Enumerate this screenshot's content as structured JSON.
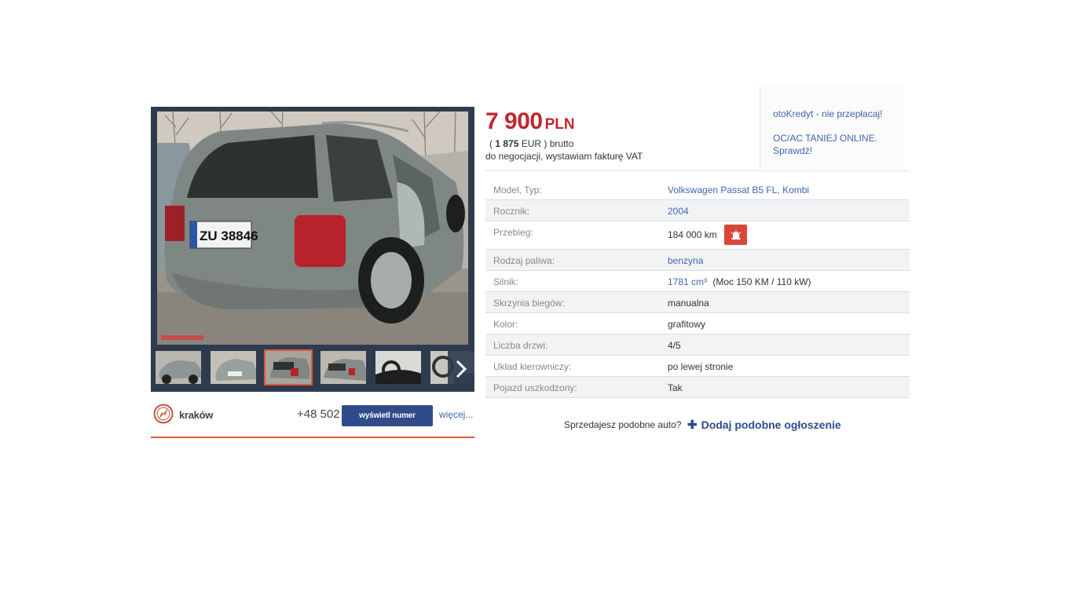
{
  "listing": {
    "price": "7 900",
    "currency": "PLN",
    "eur_prefix": "(",
    "eur_amount": "1 875",
    "eur_suffix": "EUR ) brutto",
    "negotiation": "do negocjacji, wystawiam fakturę VAT"
  },
  "side_links": [
    "otoKredyt - nie przepłacaj!",
    "OC/AC TANIEJ ONLINE.",
    "Sprawdź!"
  ],
  "contact": {
    "location": "kraków",
    "phone": "+48 502",
    "show_number_label": "wyświetl numer",
    "more_label": "więcej..."
  },
  "gallery": {
    "plate_text": "ZU 38846",
    "active_thumb": 3,
    "thumb_count": 6
  },
  "params": [
    {
      "label": "Model, Typ:",
      "value": "Volkswagen Passat B5 FL, Kombi",
      "link": true
    },
    {
      "label": "Rocznik:",
      "value": "2004",
      "link": true
    },
    {
      "label": "Przebieg:",
      "value": "184 000 km",
      "link": false
    },
    {
      "label": "Rodzaj paliwa:",
      "value": "benzyna",
      "link": true
    },
    {
      "label": "Silnik:",
      "value": "1781 cm³",
      "extra": "(Moc 150 KM / 110 kW)",
      "link": true
    },
    {
      "label": "Skrzynia biegów:",
      "value": "manualna",
      "link": false
    },
    {
      "label": "Kolor:",
      "value": "grafitowy",
      "link": false
    },
    {
      "label": "Liczba drzwi:",
      "value": "4/5",
      "link": false
    },
    {
      "label": "Układ kierowniczy:",
      "value": "po lewej stronie",
      "link": false
    },
    {
      "label": "Pojazd uszkodzony:",
      "value": "Tak",
      "link": false
    }
  ],
  "footer": {
    "question": "Sprzedajesz podobne auto?",
    "add_label": "Dodaj podobne ogłoszenie"
  },
  "colors": {
    "price_red": "#c1272d",
    "link_blue": "#3f66ae",
    "button_navy": "#2f4b8a",
    "alert_red": "#d9463a",
    "gallery_bg": "#2e3b4e"
  },
  "icons": [
    "compass-icon",
    "chevron-right-icon",
    "alarm-icon",
    "plus-icon"
  ]
}
